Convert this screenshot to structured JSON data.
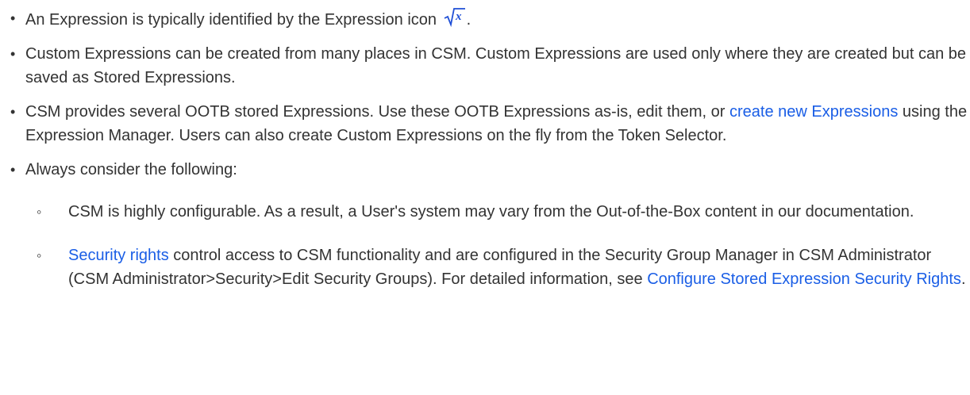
{
  "bullets": {
    "b1": {
      "text": "An Expression is typically identified by the Expression icon",
      "icon": "square-root-x-icon",
      "tail": "."
    },
    "b2": {
      "text": "Custom Expressions can be created from many places in CSM. Custom Expressions are used only where they are created but can be saved as Stored Expressions."
    },
    "b3": {
      "pre": "CSM provides several OOTB stored Expressions. Use these OOTB Expressions as-is, edit them, or",
      "link": "create new Expressions",
      "post": "using the Expression Manager. Users can also create Custom Expressions on the fly from the Token Selector."
    },
    "b4": {
      "text": "Always consider the following:",
      "sub1": {
        "text": "CSM is highly configurable. As a result, a User's system may vary from the Out-of-the-Box content in our documentation."
      },
      "sub2": {
        "link1": "Security rights",
        "mid": "control access to CSM functionality and are configured in the Security Group Manager in CSM Administrator (CSM Administrator>Security>Edit Security Groups). For detailed information, see",
        "link2": "Configure Stored Expression Security Rights",
        "tail": "."
      }
    }
  },
  "colors": {
    "text": "#333333",
    "link": "#1a5ee6",
    "icon": "#1f4fd6"
  }
}
